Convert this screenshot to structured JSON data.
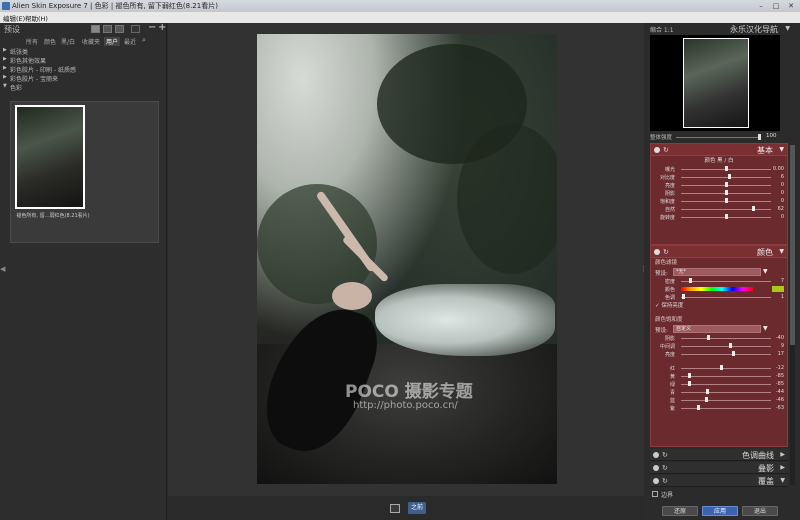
{
  "window": {
    "title": "Alien Skin Exposure 7 | 色彩 | 褪色所有, 留下弱红色(8.21看片)",
    "minimize": "–",
    "maximize": "□",
    "close": "✕"
  },
  "menu": {
    "edit": "编辑(E)",
    "help": "帮助(H)"
  },
  "left_panel": {
    "title": "预设",
    "tabs": [
      "所有",
      "颜色",
      "黑/白",
      "收藏夹",
      "用户",
      "最近"
    ],
    "selected_tab": "用户",
    "tree": [
      "纸张类",
      "彩色其他效果",
      "彩色胶片 - 印刷 - 纸质感",
      "彩色胶片 - 宝丽来",
      "色彩"
    ],
    "preset_label": "褪色所有, 留…弱红色(8.21看片)"
  },
  "center": {
    "watermark_main": "POCO 摄影专题",
    "watermark_url": "http://photo.poco.cn/",
    "before_button": "之前"
  },
  "right_panel": {
    "nav_zoom": "缩合  1:1",
    "nav_title": "永乐汉化导航",
    "strength_label": "整体强度",
    "strength_value": "100",
    "basic": {
      "title": "基本",
      "tabs": "颜色   黑 / 白",
      "rows": [
        {
          "name": "曝光",
          "value": "0.00",
          "pos": 0.5
        },
        {
          "name": "对比度",
          "value": "6",
          "pos": 0.53
        },
        {
          "name": "亮度",
          "value": "0",
          "pos": 0.5
        },
        {
          "name": "阴影",
          "value": "0",
          "pos": 0.5
        },
        {
          "name": "饱和度",
          "value": "0",
          "pos": 0.5
        },
        {
          "name": "自然",
          "value": "62",
          "pos": 0.81
        },
        {
          "name": "旋转度",
          "value": "0",
          "pos": 0.5
        }
      ]
    },
    "color": {
      "title": "颜色",
      "filter_title": "颜色滤镜",
      "preset_label": "预设:",
      "preset_value": "*无*",
      "density_label": "密度",
      "density_value": "7",
      "color_label": "颜色",
      "hue_label": "色调",
      "hue_value": "1",
      "preserve_label": "✓ 保持亮度",
      "sat_title": "颜色饱和度",
      "sat_preset_value": "自定义",
      "tone_rows": [
        {
          "name": "阴影",
          "value": "-40",
          "pos": 0.3
        },
        {
          "name": "中间调",
          "value": "9",
          "pos": 0.55
        },
        {
          "name": "亮度",
          "value": "17",
          "pos": 0.58
        }
      ],
      "hue_rows": [
        {
          "name": "红",
          "value": "-12",
          "pos": 0.44
        },
        {
          "name": "黄",
          "value": "-85",
          "pos": 0.08
        },
        {
          "name": "绿",
          "value": "-85",
          "pos": 0.08
        },
        {
          "name": "青",
          "value": "-44",
          "pos": 0.28
        },
        {
          "name": "蓝",
          "value": "-46",
          "pos": 0.27
        },
        {
          "name": "紫",
          "value": "-63",
          "pos": 0.18
        }
      ]
    },
    "collapsed": [
      "色调曲线",
      "叠影",
      "覆盖"
    ],
    "border_label": "边界",
    "buttons": {
      "reset": "还原",
      "apply": "应用",
      "exit": "退出"
    }
  }
}
